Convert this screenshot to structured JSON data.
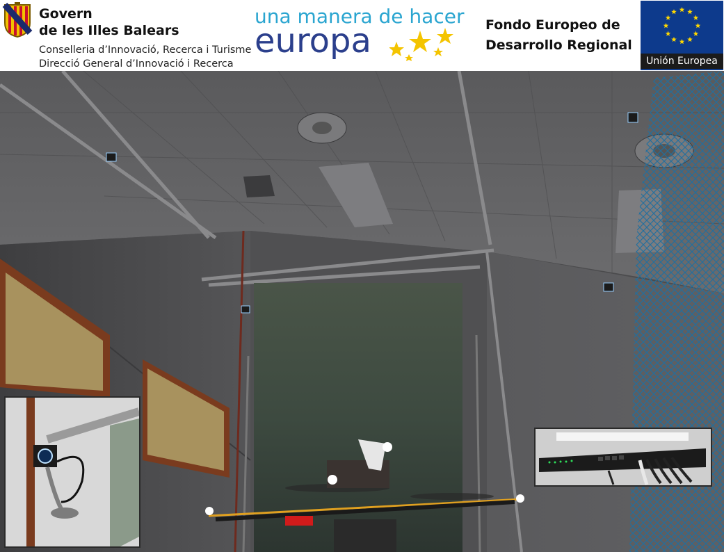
{
  "header": {
    "government": {
      "name_line1": "Govern",
      "name_line2": "de les Illes Balears",
      "department_line1": "Conselleria d’Innovació, Recerca i Turisme",
      "department_line2": "Direcció General d’Innovació i Recerca",
      "crest_icon": "balearic-coat-of-arms-icon"
    },
    "feder": {
      "slogan_line1": "una manera de hacer",
      "slogan_line2": "europa",
      "stars_icon": "gold-stars-icon"
    },
    "fund": {
      "line1": "Fondo Europeo de",
      "line2": "Desarrollo Regional"
    },
    "eu": {
      "label": "Unión Europea",
      "flag_icon": "eu-flag-icon"
    }
  },
  "colors": {
    "slogan_light_blue": "#2aa5d0",
    "slogan_dark_blue": "#2b3f8c",
    "eu_blue": "#0d3a8c",
    "eu_star_yellow": "#ffd800",
    "net_blue": "#1f6fa0",
    "frame_orange": "#e0a020"
  },
  "photo": {
    "main_icon": "indoor-flight-lab-with-quadrotor-and-cameras-photo",
    "inset_left_icon": "motion-capture-camera-closeup-photo",
    "inset_right_icon": "network-switch-closeup-photo"
  }
}
